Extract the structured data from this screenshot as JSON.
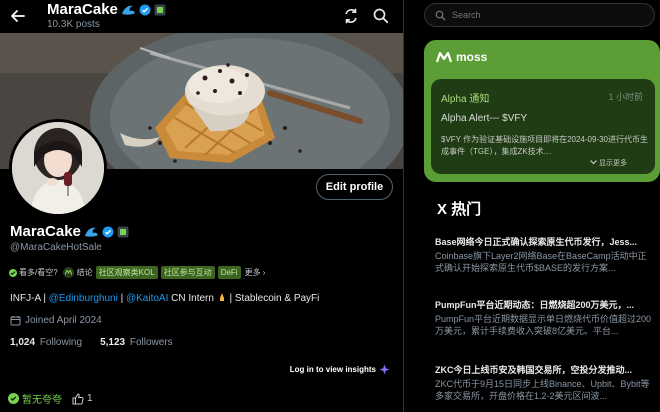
{
  "colors": {
    "accent": "#1d9bf0",
    "moss_green": "#5c9e36",
    "moss_dark": "#203c15",
    "tag_green": "#7ad050"
  },
  "header": {
    "name": "MaraCake",
    "posts": "10.3K posts"
  },
  "profile": {
    "name": "MaraCake",
    "handle": "@MaraCakeHotSale",
    "edit_label": "Edit profile",
    "joined": "Joined April 2024",
    "following_count": "1,024",
    "following_label": "Following",
    "followers_count": "5,123",
    "followers_label": "Followers",
    "bio": {
      "prefix": "INFJ-A | ",
      "link1": "@Edinburghuni",
      "sep1": " | ",
      "link2": "@KaitoAI",
      "suffix1": " CN Intern ",
      "suffix2": " | Stablecoin & PayFi"
    }
  },
  "tags": {
    "view_label": "看多/看空?",
    "graph_label": "结论",
    "chips": [
      "社区观察类KOL",
      "社区参与互动",
      "DeFi"
    ],
    "more": "更多"
  },
  "insights": {
    "label": "Log in to view insights"
  },
  "bottom": {
    "label": "暂无夸夸",
    "like_count": "1"
  },
  "search": {
    "placeholder": "Search"
  },
  "moss": {
    "brand": "moss",
    "alert_head": "Alpha 通知",
    "alert_time": "1 小时前",
    "alert_title": "Alpha Alert--- $VFY",
    "alert_body": "$VFY 作为验证基础设施项目即将在2024-09-30进行代币生成事件（TGE），集成ZK技术…",
    "show_more": "显示更多"
  },
  "trending": {
    "title": "X 热门",
    "items": [
      {
        "title": "Base网络今日正式确认探索原生代币发行，Jess...",
        "desc": "Coinbase旗下Layer2网络Base在BaseCamp活动中正式确认开始探索原生代币$BASE的发行方案..."
      },
      {
        "title": "PumpFun平台近期动态：日燃烧超200万美元，...",
        "desc": "PumpFun平台近期数据显示单日燃烧代币价值超过200万美元，累计手续费收入突破8亿美元。平台..."
      },
      {
        "title": "ZKC今日上线币安及韩国交易所，空投分发推动...",
        "desc": "ZKC代币于9月15日同步上线Binance、Upbit、Bybit等多家交易所，开盘价格在1.2-2美元区间波..."
      }
    ]
  }
}
